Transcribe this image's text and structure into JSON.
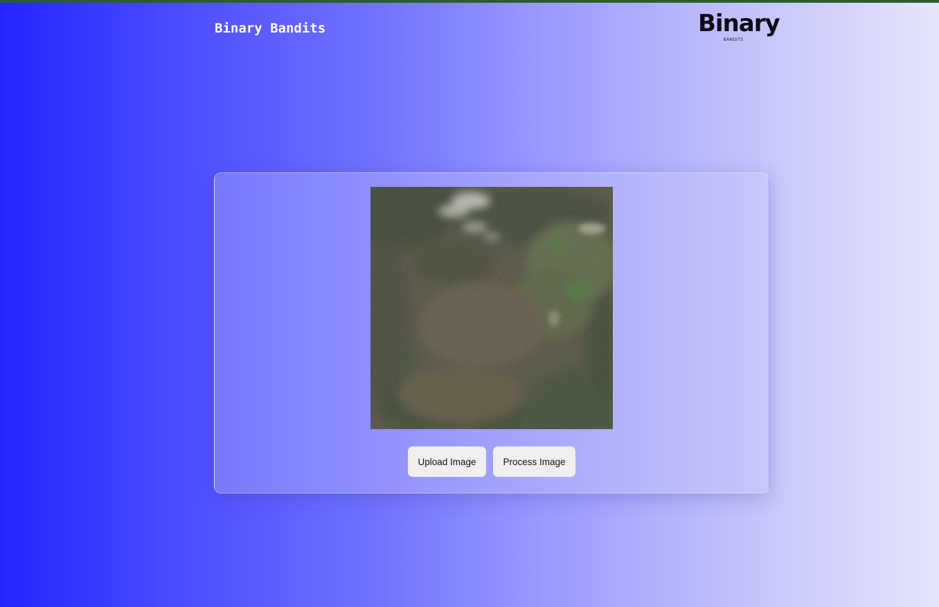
{
  "header": {
    "title": "Binary Bandits",
    "logo_text": "Binary",
    "logo_subtext": "BANDITS"
  },
  "image_preview": {
    "content": "satellite-terrain-image"
  },
  "actions": {
    "upload_label": "Upload Image",
    "process_label": "Process Image"
  },
  "colors": {
    "top_accent": "#2c5d2e",
    "gradient_left": "#2424ff",
    "gradient_right": "#e6e6fb",
    "button_bg": "#efefef"
  }
}
